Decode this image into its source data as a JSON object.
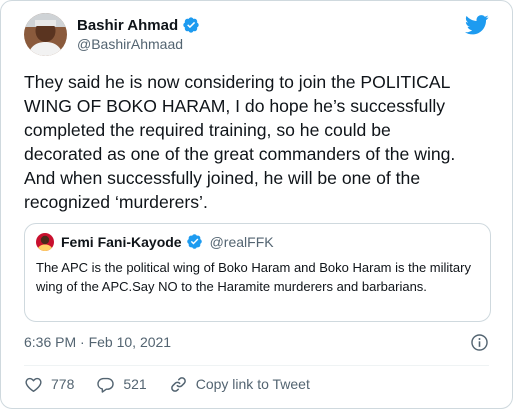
{
  "author": {
    "name": "Bashir Ahmad",
    "handle": "@BashirAhmaad"
  },
  "tweet": {
    "text": "They said he is now considering to join the POLITICAL\nWING OF BOKO HARAM, I do hope he’s successfully\ncompleted the required training, so he could be\ndecorated as one of the great commanders of the wing.\nAnd when successfully joined, he will be one of the\nrecognized ‘murderers’.",
    "timestamp": "6:36 PM · Feb 10, 2021"
  },
  "quoted": {
    "name": "Femi Fani-Kayode",
    "handle": "@realFFK",
    "text": "The APC is the political wing of Boko Haram and Boko Haram is the military wing of the APC.Say NO to the Haramite murderers and barbarians."
  },
  "actions": {
    "likes": "778",
    "replies": "521",
    "copy_link": "Copy link to Tweet"
  },
  "colors": {
    "brand": "#1d9bf0",
    "muted_text": "#536471",
    "border": "#cfd9de"
  },
  "icons": [
    "avatar",
    "verified-badge-icon",
    "twitter-bird-icon",
    "info-icon",
    "heart-icon",
    "reply-icon",
    "link-icon"
  ]
}
